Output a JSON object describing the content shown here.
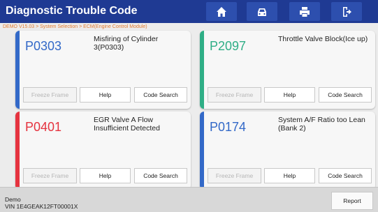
{
  "header": {
    "title": "Diagnostic Trouble Code",
    "icons": [
      "home-icon",
      "car-icon",
      "print-icon",
      "exit-icon"
    ]
  },
  "breadcrumb": "DEMO V15.03 > System Selection > ECM(Engine Control Module)",
  "colors": {
    "header": "#1f3a93",
    "blue": "#3369c8",
    "green": "#2fae86",
    "red": "#e5333f",
    "breadcrumb": "#e07a30"
  },
  "cards": [
    {
      "code": "P0303",
      "description": "Misfiring of Cylinder 3(P0303)",
      "color": "blue"
    },
    {
      "code": "P2097",
      "description": "Throttle Valve Block(Ice up)",
      "color": "green"
    },
    {
      "code": "P0401",
      "description": "EGR Valve A Flow Insufficient Detected",
      "color": "red"
    },
    {
      "code": "P0174",
      "description": "System A/F Ratio too Lean (Bank 2)",
      "color": "blue"
    }
  ],
  "buttons": {
    "freeze": "Freeze Frame",
    "help": "Help",
    "search": "Code Search"
  },
  "footer": {
    "line1": "Demo",
    "line2": "VIN 1E4GEAK12FT00001X",
    "report": "Report"
  }
}
